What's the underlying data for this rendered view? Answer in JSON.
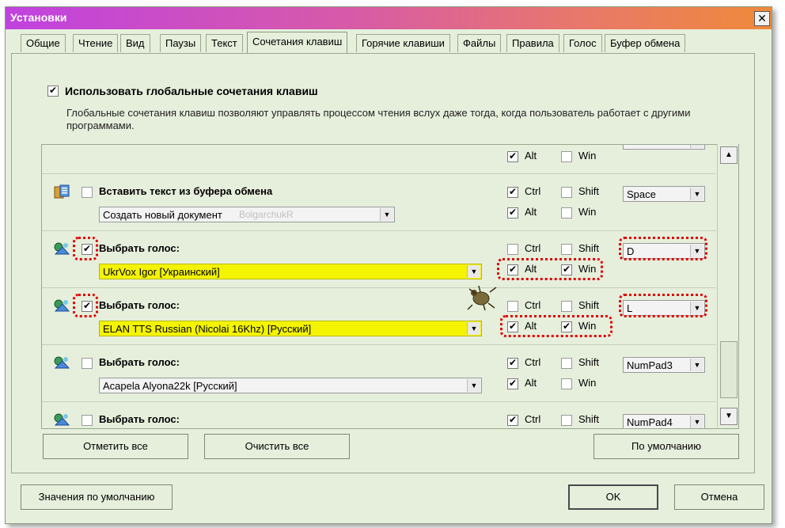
{
  "window": {
    "title": "Установки",
    "close_icon": "close-icon"
  },
  "tabs": [
    {
      "label": "Общие"
    },
    {
      "label": "Чтение"
    },
    {
      "label": "Вид"
    },
    {
      "label": "Паузы"
    },
    {
      "label": "Текст"
    },
    {
      "label": "Сочетания клавиш",
      "active": true
    },
    {
      "label": "Горячие клавиши"
    },
    {
      "label": "Файлы"
    },
    {
      "label": "Правила"
    },
    {
      "label": "Голос"
    },
    {
      "label": "Буфер обмена"
    }
  ],
  "global": {
    "checkbox_label": "Использовать глобальные сочетания клавиш",
    "checked": true,
    "description": "Глобальные сочетания клавиш позволяют управлять процессом чтения вслух даже тогда, когда пользователь работает с другими программами."
  },
  "modifiers": {
    "ctrl": "Ctrl",
    "alt": "Alt",
    "shift": "Shift",
    "win": "Win"
  },
  "check_glyph": "✔",
  "rows": [
    {
      "title": "",
      "alt": true,
      "win": false
    },
    {
      "title": "Вставить текст из буфера обмена",
      "checked": false,
      "combo": "Создать новый документ",
      "combo_hint": "BolgarchukR",
      "ctrl": true,
      "shift": false,
      "alt": true,
      "win": false,
      "key": "Space"
    },
    {
      "title": "Выбрать голос:",
      "checked": true,
      "combo": "UkrVox Igor [Украинский]",
      "ctrl": false,
      "shift": false,
      "alt": true,
      "win": true,
      "key": "D"
    },
    {
      "title": "Выбрать голос:",
      "checked": true,
      "combo": "ELAN TTS Russian (Nicolai 16Khz) [Русский]",
      "ctrl": false,
      "shift": false,
      "alt": true,
      "win": true,
      "key": "L"
    },
    {
      "title": "Выбрать голос:",
      "checked": false,
      "combo": "Acapela Alyona22k [Русский]",
      "ctrl": true,
      "shift": false,
      "alt": true,
      "win": false,
      "key": "NumPad3"
    },
    {
      "title": "Выбрать голос:",
      "checked": false,
      "ctrl": true,
      "shift": false,
      "key": "NumPad4"
    }
  ],
  "buttons": {
    "check_all": "Отметить все",
    "clear_all": "Очистить все",
    "defaults": "По умолчанию",
    "default_values": "Значения по умолчанию",
    "ok": "OK",
    "cancel": "Отмена"
  },
  "colors": {
    "highlight_yellow": "#f4f400",
    "annotation_red": "#e00000",
    "panel_bg": "#e6efdc"
  }
}
